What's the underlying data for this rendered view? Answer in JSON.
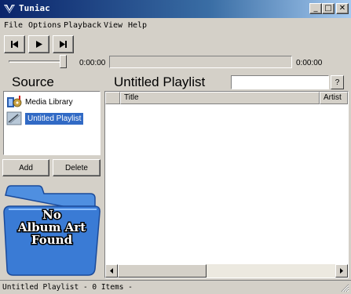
{
  "window": {
    "title": "Tuniac",
    "controls": {
      "minimize": "_",
      "maximize": "□",
      "close": "✕"
    }
  },
  "menu": [
    "File",
    "Options",
    "Playback",
    "View",
    "Help"
  ],
  "transport": {
    "buttons": [
      "previous-icon",
      "play-icon",
      "next-icon"
    ],
    "elapsed": "0:00:00",
    "remaining": "0:00:00",
    "volume_level": 1.0,
    "seek_position": 0
  },
  "source": {
    "title": "Source",
    "items": [
      {
        "label": "Media Library",
        "icon": "media-library-icon",
        "selected": false
      },
      {
        "label": "Untitled Playlist",
        "icon": "playlist-icon",
        "selected": true
      }
    ],
    "add_label": "Add",
    "delete_label": "Delete"
  },
  "album_art": {
    "text_lines": [
      "No",
      "Album Art",
      "Found"
    ]
  },
  "playlist": {
    "title": "Untitled Playlist",
    "search_value": "",
    "help_label": "?",
    "columns": [
      "",
      "Title",
      "Artist"
    ],
    "rows": []
  },
  "status": {
    "text": "Untitled Playlist - 0 Items -"
  },
  "colors": {
    "face": "#d4d0c8",
    "title_active": "#0a246a",
    "selection": "#316ac5",
    "folder": "#3a7bd5"
  }
}
